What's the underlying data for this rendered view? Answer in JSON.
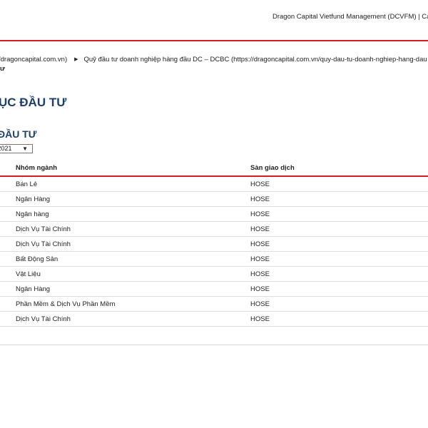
{
  "header": {
    "company_line": "Dragon Capital Vietfund Management (DCVFM) | Ca"
  },
  "breadcrumb": {
    "item1": "/dragoncapital.com.vn)",
    "item2": "Quỹ đầu tư doanh nghiệp hàng đầu DC – DCBC (https://dragoncapital.com.vn/quy-dau-tu-doanh-nghiep-hang-dau",
    "continuation": "ư",
    "separator": "▶"
  },
  "page": {
    "title": "ỤC ĐẦU TƯ",
    "section_title": "ĐẦU TƯ"
  },
  "date_filter": {
    "value": "/2021",
    "arrow": "▼"
  },
  "table": {
    "headers": [
      "",
      "Nhóm ngành",
      "Sàn giao dịch"
    ],
    "rows": [
      {
        "sector": "Bán Lẻ",
        "exchange": "HOSE"
      },
      {
        "sector": "Ngân Hàng",
        "exchange": "HOSE"
      },
      {
        "sector": "Ngân hàng",
        "exchange": "HOSE"
      },
      {
        "sector": "Dịch Vụ Tài Chính",
        "exchange": "HOSE"
      },
      {
        "sector": "Dịch Vụ Tài Chính",
        "exchange": "HOSE"
      },
      {
        "sector": "Bất Động Sản",
        "exchange": "HOSE"
      },
      {
        "sector": "Vật Liệu",
        "exchange": "HOSE"
      },
      {
        "sector": "Ngân Hàng",
        "exchange": "HOSE"
      },
      {
        "sector": "Phần Mềm & Dịch Vụ Phần Mềm",
        "exchange": "HOSE"
      },
      {
        "sector": "Dịch Vụ Tài Chính",
        "exchange": "HOSE"
      }
    ]
  },
  "colors": {
    "accent_red": "#d21f26",
    "title_blue": "#1d3f6e"
  }
}
